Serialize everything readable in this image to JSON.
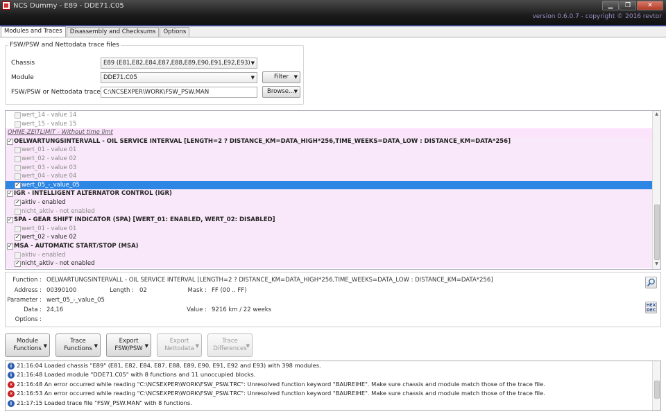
{
  "window": {
    "title": "NCS Dummy  -  E89  -  DDE71.C05",
    "version": "version 0.6.0.7 - copyright © 2016 revtor",
    "minimize": "▁",
    "maximize": "❐",
    "close": "✕"
  },
  "tabs": [
    {
      "label": "Modules and Traces"
    },
    {
      "label": "Disassembly and Checksums"
    },
    {
      "label": "Options"
    }
  ],
  "trace_group": {
    "title": "FSW/PSW and Nettodata trace files",
    "chassis_label": "Chassis",
    "chassis_value": "E89  (E81,E82,E84,E87,E88,E89,E90,E91,E92,E93)",
    "module_label": "Module",
    "module_value": "DDE71.C05",
    "filter_label": "Filter",
    "trace_label": "FSW/PSW or Nettodata trace 1",
    "trace_value": "C:\\NCSEXPER\\WORK\\FSW_PSW.MAN",
    "browse_label": "Browse..."
  },
  "tree_rows": [
    {
      "text": "wert_14  -  value 14",
      "kind": "param",
      "checked": false,
      "dim": true
    },
    {
      "text": "wert_15  -  value 15",
      "kind": "param",
      "checked": false,
      "dim": true
    },
    {
      "text": "OHNE-ZEITLIMIT  -  Without time limt",
      "kind": "header"
    },
    {
      "text": "OELWARTUNGSINTERVALL  -  OIL SERVICE INTERVAL [LENGTH=2 ? DISTANCE_KM=DATA_HIGH*256,TIME_WEEKS=DATA_LOW : DISTANCE_KM=DATA*256]",
      "kind": "function",
      "checked": true
    },
    {
      "text": "wert_01  -  value 01",
      "kind": "param",
      "checked": false,
      "dim": true
    },
    {
      "text": "wert_02  -  value 02",
      "kind": "param",
      "checked": false,
      "dim": true
    },
    {
      "text": "wert_03  -  value 03",
      "kind": "param",
      "checked": false,
      "dim": true
    },
    {
      "text": "wert_04  -  value 04",
      "kind": "param",
      "checked": false,
      "dim": true
    },
    {
      "text": "wert_05_-_value_05",
      "kind": "param",
      "checked": true,
      "selected": true
    },
    {
      "text": "IGR  -  INTELLIGENT ALTERNATOR CONTROL (IGR)",
      "kind": "function",
      "checked": true
    },
    {
      "text": "aktiv  -  enabled",
      "kind": "param",
      "checked": true,
      "dim": false
    },
    {
      "text": "nicht_aktiv  -  not enabled",
      "kind": "param",
      "checked": false,
      "dim": true
    },
    {
      "text": "SPA  -  GEAR SHIFT INDICATOR (SPA) [WERT_01: ENABLED, WERT_02: DISABLED]",
      "kind": "function",
      "checked": true
    },
    {
      "text": "wert_01  -  value 01",
      "kind": "param",
      "checked": false,
      "dim": true
    },
    {
      "text": "wert_02  -  value 02",
      "kind": "param",
      "checked": true,
      "dim": false
    },
    {
      "text": "MSA  -  AUTOMATIC START/STOP (MSA)",
      "kind": "function",
      "checked": true
    },
    {
      "text": "aktiv  -  enabled",
      "kind": "param",
      "checked": false,
      "dim": true
    },
    {
      "text": "nicht_aktiv  -  not enabled",
      "kind": "param",
      "checked": true,
      "dim": false
    }
  ],
  "details": {
    "function_label": "Function :",
    "function_value": "OELWARTUNGSINTERVALL  -  OIL SERVICE INTERVAL [LENGTH=2 ? DISTANCE_KM=DATA_HIGH*256,TIME_WEEKS=DATA_LOW : DISTANCE_KM=DATA*256]",
    "address_label": "Address :",
    "address_value": "00390100",
    "length_label": "Length :",
    "length_value": "02",
    "mask_label": "Mask :",
    "mask_value": "FF  (00 .. FF)",
    "parameter_label": "Parameter :",
    "parameter_value": "wert_05_-_value_05",
    "data_label": "Data :",
    "data_value": "24,16",
    "value_label": "Value :",
    "value_value": "9216 km / 22 weeks",
    "options_label": "Options :",
    "hexdec_label": "HEX DEC"
  },
  "actions": [
    {
      "line1": "Module",
      "line2": "Functions",
      "enabled": true
    },
    {
      "line1": "Trace",
      "line2": "Functions",
      "enabled": true
    },
    {
      "line1": "Export",
      "line2": "FSW/PSW",
      "enabled": true
    },
    {
      "line1": "Export",
      "line2": "Nettodata",
      "enabled": false
    },
    {
      "line1": "Trace",
      "line2": "Differences",
      "enabled": false
    }
  ],
  "log": [
    {
      "type": "info",
      "text": "21:16:04  Loaded chassis \"E89\" (E81, E82, E84, E87, E88, E89, E90, E91, E92 and E93) with 398 modules."
    },
    {
      "type": "info",
      "text": "21:16:48  Loaded module \"DDE71.C05\" with 8 functions and 11 unoccupied blocks."
    },
    {
      "type": "error",
      "text": "21:16:48  An error occurred while reading \"C:\\NCSEXPER\\WORK\\FSW_PSW.TRC\": Unresolved function keyword \"BAUREIHE\". Make sure chassis and module match those of the trace file."
    },
    {
      "type": "error",
      "text": "21:16:53  An error occurred while reading \"C:\\NCSEXPER\\WORK\\FSW_PSW.TRC\": Unresolved function keyword \"BAUREIHE\". Make sure chassis and module match those of the trace file."
    },
    {
      "type": "info",
      "text": "21:17:15  Loaded trace file \"FSW_PSW.MAN\" with 8 functions."
    }
  ]
}
